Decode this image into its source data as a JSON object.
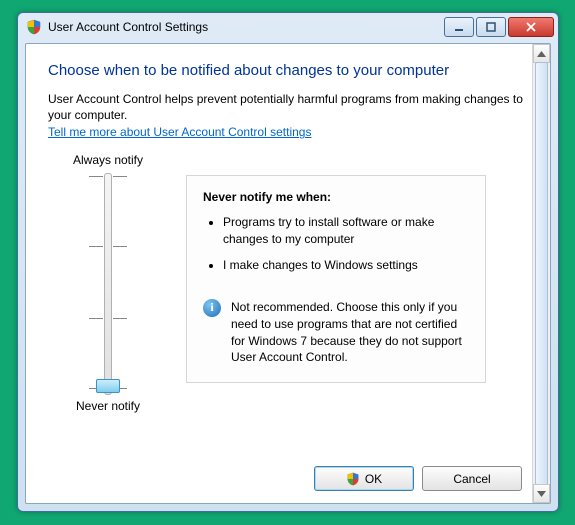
{
  "titlebar": {
    "title": "User Account Control Settings"
  },
  "content": {
    "headline": "Choose when to be notified about changes to your computer",
    "intro": "User Account Control helps prevent potentially harmful programs from making changes to your computer.",
    "link": "Tell me more about User Account Control settings"
  },
  "slider": {
    "top_label": "Always notify",
    "bottom_label": "Never notify",
    "position": 0
  },
  "description": {
    "title": "Never notify me when:",
    "bullets": [
      "Programs try to install software or make changes to my computer",
      "I make changes to Windows settings"
    ],
    "note": "Not recommended. Choose this only if you need to use programs that are not certified for Windows 7 because they do not support User Account Control."
  },
  "buttons": {
    "ok": "OK",
    "cancel": "Cancel"
  }
}
